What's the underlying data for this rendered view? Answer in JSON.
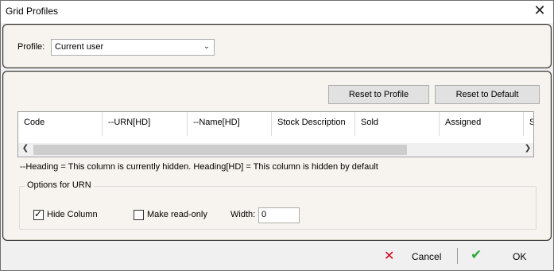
{
  "window": {
    "title": "Grid Profiles",
    "close_icon": "close-icon"
  },
  "profile": {
    "label": "Profile:",
    "selected": "Current user"
  },
  "buttons": {
    "reset_profile": "Reset to Profile",
    "reset_default": "Reset to Default"
  },
  "grid": {
    "columns": [
      "Code",
      "--URN[HD]",
      "--Name[HD]",
      "Stock Description",
      "Sold",
      "Assigned",
      "S"
    ]
  },
  "note": "--Heading = This column is currently hidden.  Heading[HD] = This column is hidden by default",
  "options": {
    "legend": "Options for URN",
    "hide_column_label": "Hide Column",
    "hide_column_checked": true,
    "read_only_label": "Make read-only",
    "read_only_checked": false,
    "width_label": "Width:",
    "width_value": "0"
  },
  "footer": {
    "cancel_label": "Cancel",
    "ok_label": "OK"
  },
  "colors": {
    "cancel_icon": "#d0021b",
    "ok_icon": "#2da93a",
    "panel_bg": "#f7f3ee"
  }
}
